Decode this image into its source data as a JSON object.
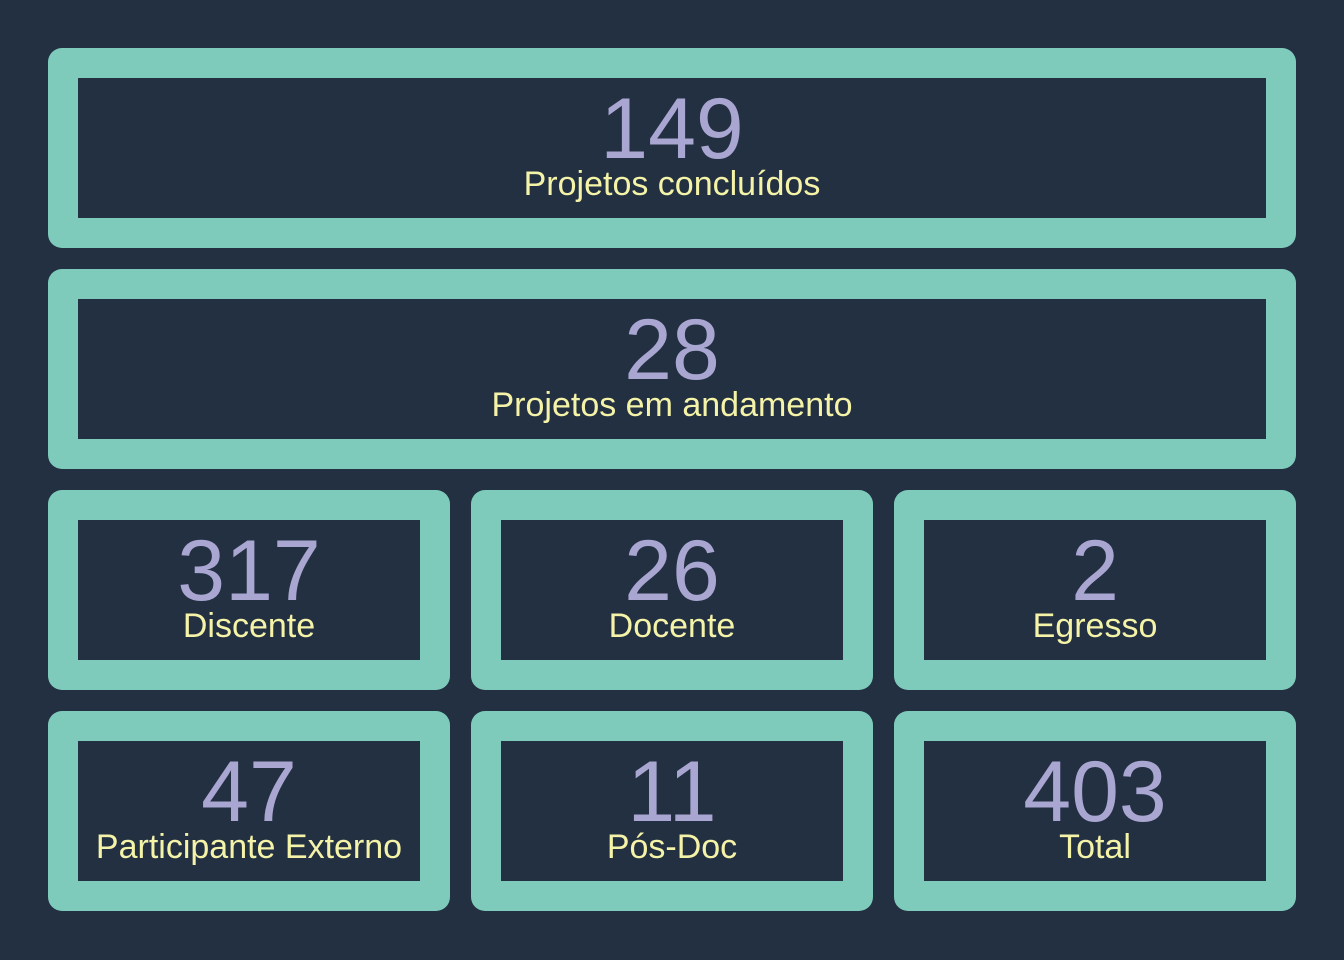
{
  "colors": {
    "background": "#223042",
    "card_border": "#7ecbbc",
    "value_text": "#aaa6d2",
    "label_text": "#f5f3a8"
  },
  "stats": {
    "completed": {
      "value": "149",
      "label": "Projetos concluídos"
    },
    "ongoing": {
      "value": "28",
      "label": "Projetos em andamento"
    },
    "discente": {
      "value": "317",
      "label": "Discente"
    },
    "docente": {
      "value": "26",
      "label": "Docente"
    },
    "egresso": {
      "value": "2",
      "label": "Egresso"
    },
    "externo": {
      "value": "47",
      "label": "Participante Externo"
    },
    "posdoc": {
      "value": "11",
      "label": "Pós-Doc"
    },
    "total": {
      "value": "403",
      "label": "Total"
    }
  }
}
